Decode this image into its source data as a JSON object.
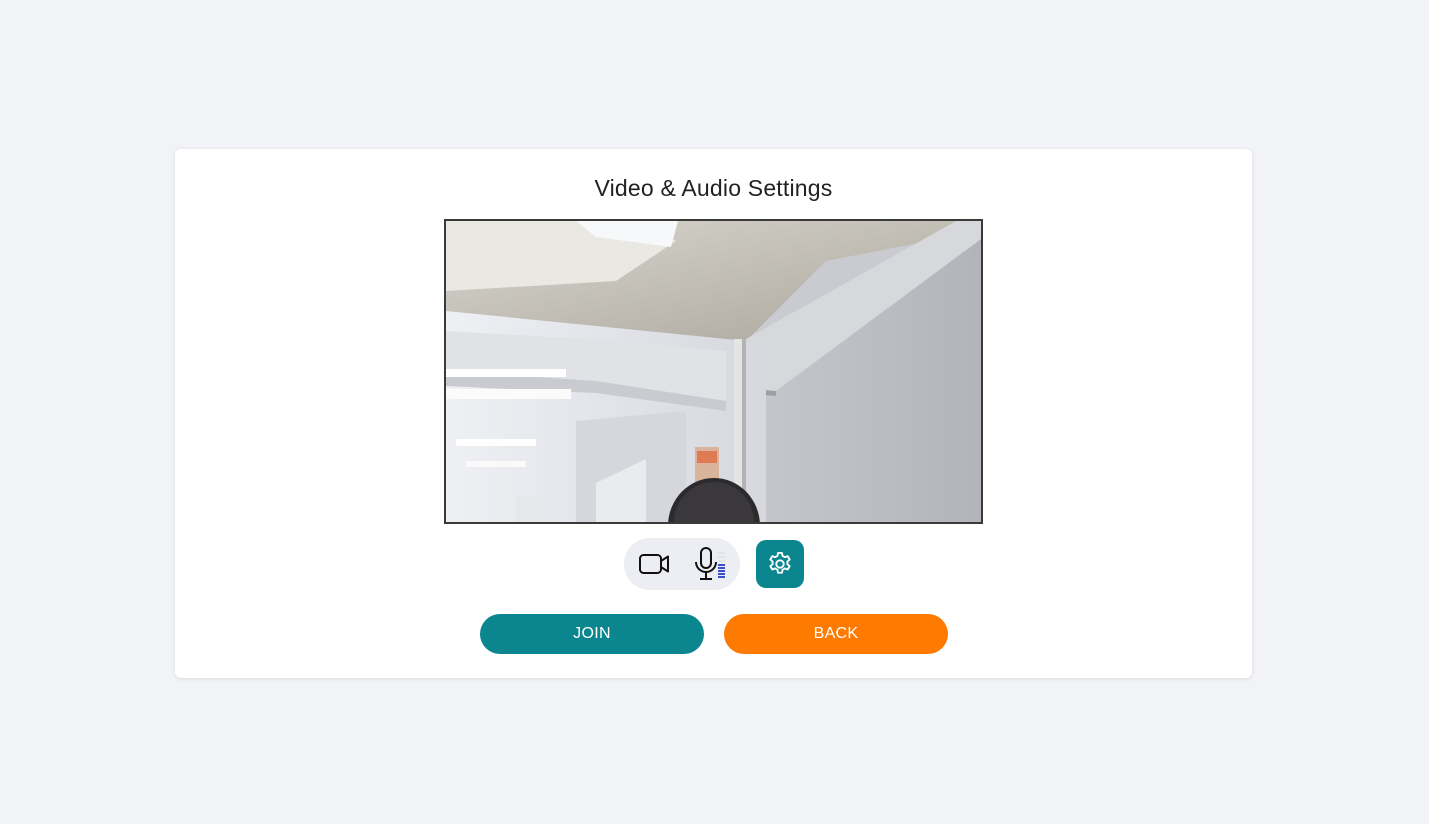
{
  "dialog": {
    "title": "Video & Audio Settings"
  },
  "preview": {
    "camera_feed": "camera-preview"
  },
  "controls": {
    "camera_icon": "video-camera-icon",
    "mic_icon": "microphone-icon",
    "mic_level_icon": "audio-level-meter-icon",
    "settings_icon": "gear-icon"
  },
  "actions": {
    "join_label": "JOIN",
    "back_label": "BACK"
  },
  "colors": {
    "background": "#f2f3f7",
    "card": "#ffffff",
    "primary": "#0b868f",
    "secondary": "#ff7a00",
    "media_group": "#eceef3",
    "mic_level": "#3a4fd0"
  }
}
